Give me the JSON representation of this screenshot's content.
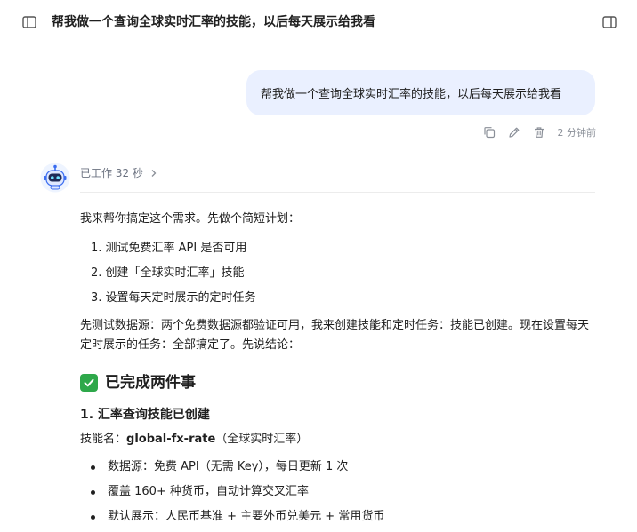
{
  "header": {
    "title": "帮我做一个查询全球实时汇率的技能，以后每天展示给我看"
  },
  "user_message": {
    "text": "帮我做一个查询全球实时汇率的技能，以后每天展示给我看",
    "time": "2 分钟前"
  },
  "assistant": {
    "worked_label": "已工作 32 秒",
    "intro": "我来帮你搞定这个需求。先做个简短计划：",
    "plan": [
      "1. 测试免费汇率 API 是否可用",
      "2. 创建「全球实时汇率」技能",
      "3. 设置每天定时展示的定时任务"
    ],
    "status_text": "先测试数据源：两个免费数据源都验证可用，我来创建技能和定时任务：技能已创建。现在设置每天定时展示的任务：全部搞定了。先说结论：",
    "done_heading": "已完成两件事",
    "section1_heading": "1. 汇率查询技能已创建",
    "skill_label": "技能名：",
    "skill_name": "global-fx-rate",
    "skill_desc": "（全球实时汇率）",
    "bullets": [
      "数据源：免费 API（无需 Key），每日更新 1 次",
      "覆盖 160+ 种货币，自动计算交叉汇率",
      "默认展示：人民币基准 + 主要外币兑美元 + 常用货币"
    ]
  },
  "colors": {
    "user_bubble": "#eaf0ff",
    "check_green": "#2ea84a",
    "muted_text": "#6b7280"
  }
}
